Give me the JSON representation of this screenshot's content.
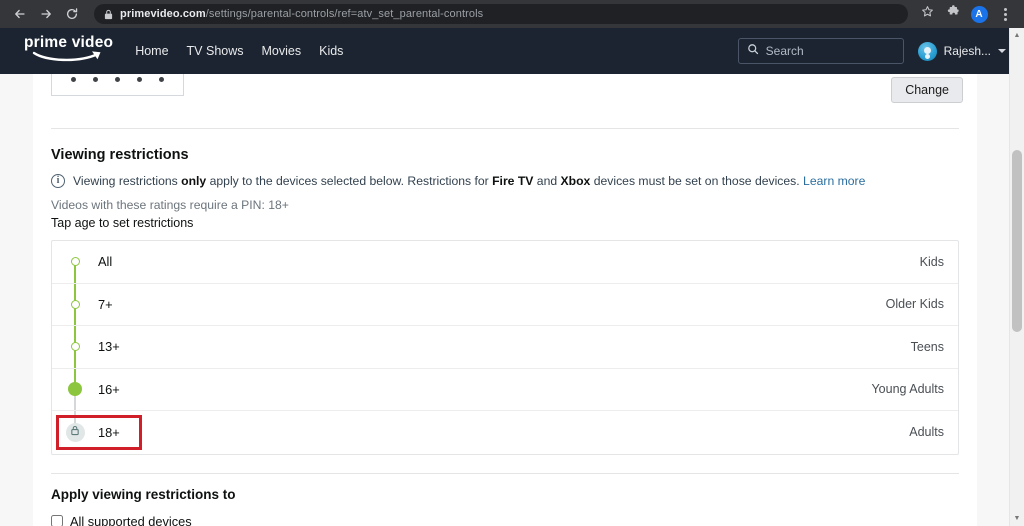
{
  "browser": {
    "back_icon": "arrow-left-icon",
    "forward_icon": "arrow-right-icon",
    "reload_icon": "reload-icon",
    "site_lock_icon": "padlock-icon",
    "url_domain": "primevideo.com",
    "url_path": "/settings/parental-controls/ref=atv_set_parental-controls",
    "bookmark_icon": "star-icon",
    "extensions_icon": "puzzle-piece-icon",
    "profile_initial": "A",
    "menu_icon": "three-dot-menu-icon"
  },
  "site_header": {
    "logo_text": "prime video",
    "nav": [
      {
        "label": "Home"
      },
      {
        "label": "TV Shows"
      },
      {
        "label": "Movies"
      },
      {
        "label": "Kids"
      }
    ],
    "search_placeholder": "Search",
    "search_value": "",
    "search_icon": "search-icon",
    "profile_name": "Rajesh...",
    "profile_caret": "chevron-down-icon"
  },
  "pin_section": {
    "pin_masked": "•••••",
    "pin_digits": 5,
    "change_label": "Change"
  },
  "viewing_restrictions": {
    "title": "Viewing restrictions",
    "info_icon": "info-circle-icon",
    "info_text_1": "Viewing restrictions ",
    "info_bold_1": "only",
    "info_text_2": " apply to the devices selected below. Restrictions for ",
    "info_bold_2": "Fire TV",
    "info_text_3": " and ",
    "info_bold_3": "Xbox",
    "info_text_4": " devices must be set on those devices. ",
    "learn_more": "Learn more",
    "pin_requirement": "Videos with these ratings require a PIN: 18+",
    "tap_hint": "Tap age to set restrictions",
    "ratings": [
      {
        "age": "All",
        "description": "Kids",
        "state": "open"
      },
      {
        "age": "7+",
        "description": "Older Kids",
        "state": "open"
      },
      {
        "age": "13+",
        "description": "Teens",
        "state": "open"
      },
      {
        "age": "16+",
        "description": "Young Adults",
        "state": "selected"
      },
      {
        "age": "18+",
        "description": "Adults",
        "state": "locked",
        "lock_icon": "padlock-icon",
        "highlighted": true
      }
    ]
  },
  "apply_section": {
    "title": "Apply viewing restrictions to",
    "checkbox_label": "All supported devices",
    "checkbox_checked": false
  },
  "colors": {
    "brand_dark": "#1b2430",
    "track_green": "#8cc63e",
    "highlight_red": "#d11f2a",
    "link_blue": "#2b6e9e"
  }
}
